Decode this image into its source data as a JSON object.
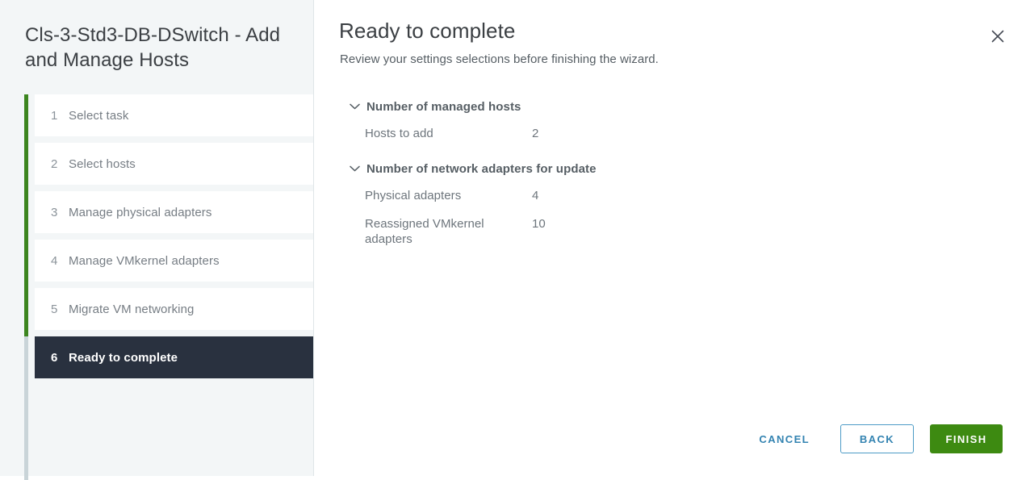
{
  "sidebar": {
    "title": "Cls-3-Std3-DB-DSwitch - Add and Manage Hosts",
    "steps": [
      {
        "num": "1",
        "label": "Select task"
      },
      {
        "num": "2",
        "label": "Select hosts"
      },
      {
        "num": "3",
        "label": "Manage physical adapters"
      },
      {
        "num": "4",
        "label": "Manage VMkernel adapters"
      },
      {
        "num": "5",
        "label": "Migrate VM networking"
      },
      {
        "num": "6",
        "label": "Ready to complete"
      }
    ]
  },
  "main": {
    "title": "Ready to complete",
    "subtitle": "Review your settings selections before finishing the wizard.",
    "close_icon": "close-icon",
    "sections": [
      {
        "title": "Number of managed hosts",
        "chevron_icon": "chevron-down-icon",
        "rows": [
          {
            "label": "Hosts to add",
            "value": "2"
          }
        ]
      },
      {
        "title": "Number of network adapters for update",
        "chevron_icon": "chevron-down-icon",
        "rows": [
          {
            "label": "Physical adapters",
            "value": "4"
          },
          {
            "label": "Reassigned VMkernel adapters",
            "value": "10"
          }
        ]
      }
    ]
  },
  "footer": {
    "cancel_label": "CANCEL",
    "back_label": "BACK",
    "finish_label": "FINISH"
  },
  "colors": {
    "accent_green": "#3d8a11",
    "rail_green": "#3c851f",
    "active_step_bg": "#29313f",
    "link_blue": "#3383b1",
    "sidebar_bg": "#f3f6f7"
  }
}
